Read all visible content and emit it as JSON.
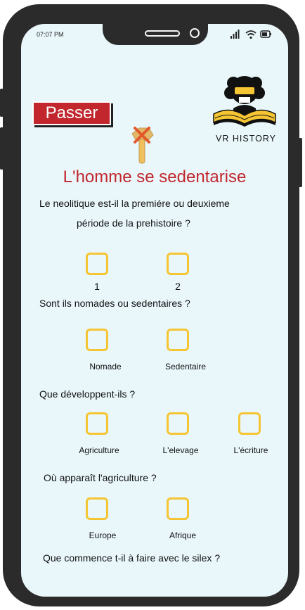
{
  "status": {
    "time": "07:07 PM"
  },
  "header": {
    "skip_label": "Passer",
    "logo_text": "VR HISTORY"
  },
  "title": "L'homme se sedentarise",
  "questions": [
    {
      "text_line1": "Le neolitique est-il la premiére ou deuxieme",
      "text_line2": "période de la prehistoire ?",
      "options": [
        "1",
        "2"
      ]
    },
    {
      "text": "Sont ils nomades ou sedentaires ?",
      "options": [
        "Nomade",
        "Sedentaire"
      ]
    },
    {
      "text": "Que développent-ils ?",
      "options": [
        "Agriculture",
        "L'elevage",
        "L'écriture"
      ]
    },
    {
      "text": "Où apparaît l'agriculture ?",
      "options": [
        "Europe",
        "Afrique"
      ]
    },
    {
      "text": "Que commence t-il à faire avec le silex ?"
    }
  ],
  "colors": {
    "accent": "#c1272d",
    "checkbox": "#f5c533",
    "screen_bg": "#e9f7fb"
  },
  "icons": [
    "signal-icon",
    "wifi-icon",
    "battery-icon",
    "tool-icon",
    "logo-icon"
  ]
}
